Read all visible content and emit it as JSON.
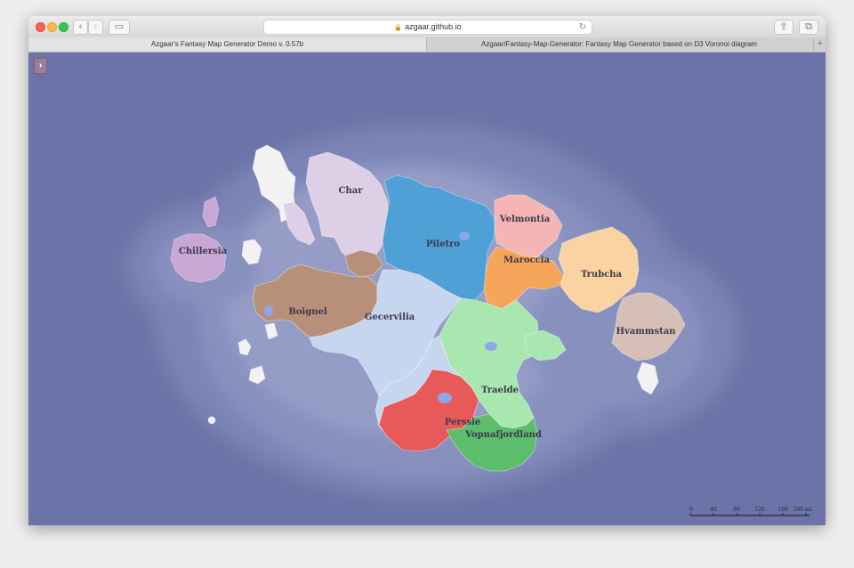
{
  "browser": {
    "url": "azgaar.github.io",
    "tabs": [
      {
        "label": "Azgaar's Fantasy Map Generator Demo v. 0.57b"
      },
      {
        "label": "Azgaar/Fantasy-Map-Generator: Fantasy Map Generator based on D3 Voronoi diagram"
      }
    ]
  },
  "map": {
    "states": [
      {
        "name": "Char"
      },
      {
        "name": "Piletro"
      },
      {
        "name": "Velmontia"
      },
      {
        "name": "Maroccia"
      },
      {
        "name": "Trubcha"
      },
      {
        "name": "Chillersia"
      },
      {
        "name": "Boignel"
      },
      {
        "name": "Gecervilia"
      },
      {
        "name": "Hvammstan"
      },
      {
        "name": "Traelde"
      },
      {
        "name": "Perssie"
      },
      {
        "name": "Vopnafjordland"
      }
    ],
    "scale_bar": {
      "ticks": [
        "0",
        "40",
        "80",
        "120",
        "160",
        "200 mi"
      ]
    },
    "colors": {
      "ocean": "#6b73a8",
      "char": "#ddcfe6",
      "piletro": "#4fa0d6",
      "velmontia": "#f5b5b5",
      "maroccia": "#f5a65a",
      "trubcha": "#f9d3a2",
      "chillersia": "#c8a7d4",
      "boignel": "#b8907a",
      "gecervilia": "#c7d6ef",
      "hvammstan": "#d6bfb5",
      "traelde": "#a8e8b0",
      "perssie": "#e85a5a",
      "vopnafjordland": "#5cbd6c",
      "neutral": "#f2f2f2"
    }
  }
}
